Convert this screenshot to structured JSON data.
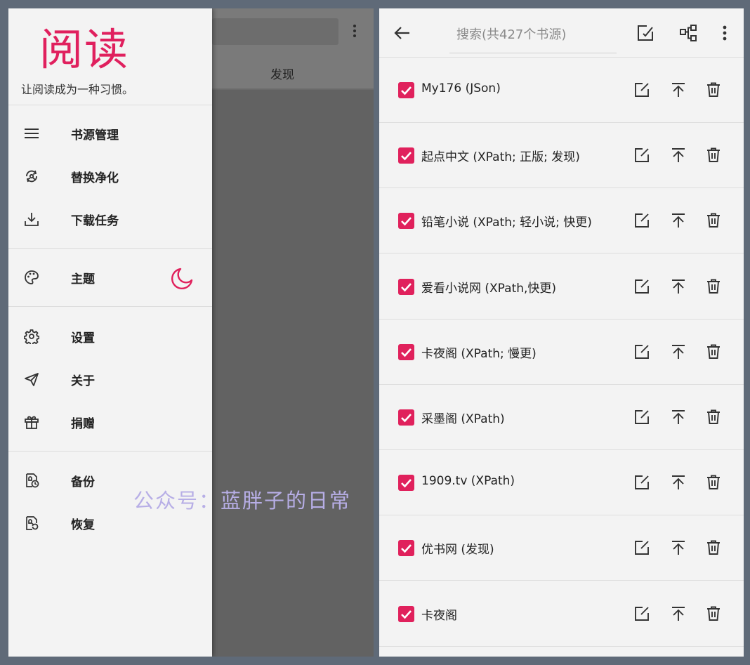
{
  "left": {
    "background": {
      "tab_label": "发现"
    },
    "drawer": {
      "logo": "阅读",
      "slogan": "让阅读成为一种习惯。",
      "sections": [
        [
          {
            "icon": "list-icon",
            "label": "书源管理"
          },
          {
            "icon": "replace-icon",
            "label": "替换净化"
          },
          {
            "icon": "download-icon",
            "label": "下载任务"
          }
        ],
        [
          {
            "icon": "palette-icon",
            "label": "主题"
          }
        ],
        [
          {
            "icon": "gear-icon",
            "label": "设置"
          },
          {
            "icon": "send-icon",
            "label": "关于"
          },
          {
            "icon": "gift-icon",
            "label": "捐赠"
          }
        ],
        [
          {
            "icon": "backup-icon",
            "label": "备份"
          },
          {
            "icon": "restore-icon",
            "label": "恢复"
          }
        ]
      ],
      "theme_toggle_icon": "moon-icon"
    }
  },
  "watermark": "公众号：蓝胖子的日常",
  "right": {
    "search": {
      "placeholder": "搜索(共427个书源)"
    },
    "toolbar_icons": [
      "back-arrow-icon",
      "edit-icon",
      "group-icon",
      "more-vert-icon"
    ],
    "sources": [
      {
        "name": "My176 (JSon)",
        "checked": true
      },
      {
        "name": "起点中文 (XPath; 正版; 发现)",
        "checked": true
      },
      {
        "name": "铅笔小说 (XPath; 轻小说; 快更)",
        "checked": true
      },
      {
        "name": "爱看小说网 (XPath,快更)",
        "checked": true
      },
      {
        "name": "卡夜阁 (XPath; 慢更)",
        "checked": true
      },
      {
        "name": "采墨阁 (XPath)",
        "checked": true
      },
      {
        "name": "1909.tv (XPath)",
        "checked": true
      },
      {
        "name": "优书网 (发现)",
        "checked": true
      },
      {
        "name": "卡夜阁",
        "checked": true
      }
    ]
  },
  "colors": {
    "accent": "#e0215c",
    "watermark": "#b7aee6",
    "background": "#5f6a78"
  }
}
